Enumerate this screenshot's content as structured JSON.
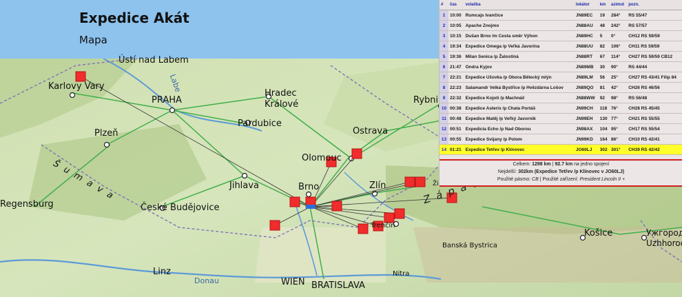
{
  "header": {
    "title": "Expedice Akát",
    "subtitle": "Mapa"
  },
  "log": {
    "columns": [
      "#",
      "čas",
      "volačka",
      "lokátor",
      "km",
      "azimut",
      "pozn."
    ],
    "rows": [
      [
        "1",
        "10:00",
        "Rumcajs Ivančice",
        "JN89EC",
        "19",
        "284°",
        "RS 55/47"
      ],
      [
        "2",
        "10:05",
        "Apache Znojmo",
        "JN88AU",
        "48",
        "242°",
        "RS 57/57"
      ],
      [
        "3",
        "10:15",
        "Dušan Brno /m Cesta směr Výhon",
        "JN89HC",
        "5",
        "0°",
        "CH12 RS 59/59"
      ],
      [
        "4",
        "19:34",
        "Expedice Omega /p Veľká Javorina",
        "JN88UU",
        "82",
        "106°",
        "CH11 RS 59/59"
      ],
      [
        "5",
        "19:36",
        "Milan Senica /p Žalostiná",
        "JN88RT",
        "67",
        "114°",
        "CH27 RS 59/59 CB12"
      ],
      [
        "6",
        "21:47",
        "Ondra Kyjov",
        "JN89MB",
        "30",
        "90°",
        "RS 44/44"
      ],
      [
        "7",
        "22:21",
        "Expedice Užovka /p Obora Bělecký mlýn",
        "JN89LM",
        "56",
        "25°",
        "CH27 RS 43/41 Filip 84"
      ],
      [
        "8",
        "22:23",
        "Salamandr Velká Bystřice /p Hvězdárna Lošov",
        "JN89QO",
        "81",
        "42°",
        "CH26 RS 46/56"
      ],
      [
        "9",
        "22:32",
        "Expedice Kojoti /p Machnáč",
        "JN88WW",
        "92",
        "98°",
        "RS 56/48"
      ],
      [
        "10",
        "00:38",
        "Expedice Asterix /p Chata Portáš",
        "JN99CH",
        "118",
        "76°",
        "CH28 RS 45/45"
      ],
      [
        "11",
        "00:48",
        "Expedice Matěj /p Veľký Javorník",
        "JN99EH",
        "130",
        "77°",
        "CH21 RS 55/55"
      ],
      [
        "12",
        "00:51",
        "Expedicia Echo /p Nad Oborou",
        "JN98AX",
        "104",
        "95°",
        "CH17 RS 55/54"
      ],
      [
        "13",
        "00:55",
        "Expedice Svijany /p Polom",
        "JN99KD",
        "164",
        "86°",
        "CH10 RS 42/41"
      ],
      [
        "14",
        "01:21",
        "Expedice Tetřev /p Klínovec",
        "JO60LJ",
        "302",
        "301°",
        "CH39 RS 42/42"
      ]
    ],
    "highlight_row": 14
  },
  "summary": {
    "total_prefix": "Celkem:",
    "total_km": "1298 km",
    "avg_sep": "|",
    "avg_km": "92.7 km",
    "avg_suffix": "na jedno spojení",
    "farthest_prefix": "Nejdelší:",
    "farthest": "302km (Expedice Tetřev /p Klínovec v JO60LJ)",
    "band_prefix": "Použité pásmo:",
    "band": "CB",
    "device_prefix": "| Použité zařízení:",
    "device": "President Lincoln II +"
  },
  "map": {
    "labels": [
      {
        "text": "Ústí nad Labem",
        "size": 13,
        "color": "#111"
      },
      {
        "text": "Labe",
        "size": 11,
        "color": "#3a6aa0"
      },
      {
        "text": "Karlovy Vary",
        "size": 13,
        "color": "#111"
      },
      {
        "text": "PRAHA",
        "size": 13,
        "color": "#111"
      },
      {
        "text": "Hradec",
        "size": 13,
        "color": "#111"
      },
      {
        "text": "Králové",
        "size": 13,
        "color": "#111"
      },
      {
        "text": "Pardubice",
        "size": 13,
        "color": "#111"
      },
      {
        "text": "Rybni",
        "size": 13,
        "color": "#111"
      },
      {
        "text": "Plzeň",
        "size": 13,
        "color": "#111"
      },
      {
        "text": "Ostrava",
        "size": 13,
        "color": "#111"
      },
      {
        "text": "Olomouc",
        "size": 13,
        "color": "#111"
      },
      {
        "text": "Šumava",
        "size": 13,
        "color": "#111"
      },
      {
        "text": "Jihlava",
        "size": 13,
        "color": "#111"
      },
      {
        "text": "Brno",
        "size": 13,
        "color": "#111"
      },
      {
        "text": "Zlín",
        "size": 13,
        "color": "#111"
      },
      {
        "text": "Žilina",
        "size": 9,
        "color": "#111"
      },
      {
        "text": "Regensburg",
        "size": 13,
        "color": "#111"
      },
      {
        "text": "České Budějovice",
        "size": 13,
        "color": "#111"
      },
      {
        "text": "Západné Karpaty",
        "size": 15,
        "color": "#222"
      },
      {
        "text": "Košice",
        "size": 13,
        "color": "#111"
      },
      {
        "text": "Ужгород",
        "size": 12,
        "color": "#111"
      },
      {
        "text": "Uzhhorod",
        "size": 12,
        "color": "#111"
      },
      {
        "text": "Banská Bystrica",
        "size": 10,
        "color": "#111"
      },
      {
        "text": "Trenčín",
        "size": 10,
        "color": "#111"
      },
      {
        "text": "Linz",
        "size": 13,
        "color": "#111"
      },
      {
        "text": "Donau",
        "size": 11,
        "color": "#3a6aa0"
      },
      {
        "text": "WIEN",
        "size": 13,
        "color": "#111"
      },
      {
        "text": "BRATISLAVA",
        "size": 13,
        "color": "#111"
      },
      {
        "text": "Nitra",
        "size": 10,
        "color": "#111"
      }
    ]
  }
}
